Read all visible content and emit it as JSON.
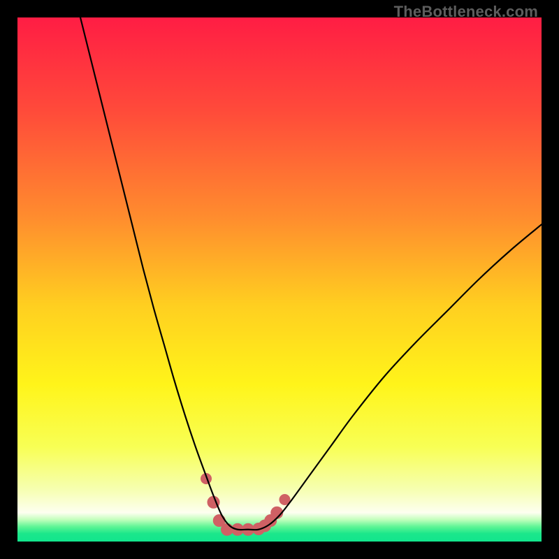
{
  "watermark": "TheBottleneck.com",
  "colors": {
    "frame": "#000000",
    "marker": "#cf6064",
    "curve": "#000000"
  },
  "chart_data": {
    "type": "line",
    "title": "",
    "xlabel": "",
    "ylabel": "",
    "xlim": [
      0,
      100
    ],
    "ylim": [
      0,
      100
    ],
    "grid": false,
    "legend": false,
    "gradient_stops": [
      {
        "offset": 0.0,
        "color": "#ff1d44"
      },
      {
        "offset": 0.18,
        "color": "#ff4b3a"
      },
      {
        "offset": 0.38,
        "color": "#ff8c2e"
      },
      {
        "offset": 0.55,
        "color": "#ffcf20"
      },
      {
        "offset": 0.7,
        "color": "#fff41a"
      },
      {
        "offset": 0.82,
        "color": "#f8ff55"
      },
      {
        "offset": 0.9,
        "color": "#f6ffb0"
      },
      {
        "offset": 0.945,
        "color": "#fdfff0"
      },
      {
        "offset": 0.958,
        "color": "#c3ffbd"
      },
      {
        "offset": 0.972,
        "color": "#5cf595"
      },
      {
        "offset": 0.985,
        "color": "#1be78b"
      },
      {
        "offset": 1.0,
        "color": "#12e58d"
      }
    ],
    "series": [
      {
        "name": "bottleneck-curve",
        "x": [
          12.0,
          14.0,
          16.0,
          18.0,
          20.0,
          22.0,
          24.0,
          26.0,
          28.0,
          30.0,
          32.0,
          34.0,
          36.0,
          37.5,
          39.0,
          40.5,
          42.0,
          44.0,
          46.0,
          48.0,
          50.0,
          52.0,
          56.0,
          60.0,
          64.0,
          70.0,
          76.0,
          82.0,
          88.0,
          94.0,
          100.0
        ],
        "y": [
          100.0,
          92.0,
          84.0,
          76.0,
          68.0,
          60.0,
          52.0,
          44.5,
          37.5,
          30.5,
          24.0,
          18.0,
          12.5,
          8.5,
          5.0,
          3.0,
          2.3,
          2.3,
          2.3,
          3.2,
          5.0,
          7.5,
          13.0,
          18.5,
          24.0,
          31.5,
          38.0,
          44.0,
          50.0,
          55.5,
          60.5
        ]
      }
    ],
    "markers": {
      "name": "highlight-points",
      "x": [
        36.0,
        37.4,
        38.5,
        40.0,
        42.0,
        44.0,
        46.0,
        47.2,
        48.3,
        49.5,
        51.0
      ],
      "y": [
        12.0,
        7.5,
        4.0,
        2.3,
        2.3,
        2.3,
        2.4,
        3.0,
        4.0,
        5.5,
        8.0
      ],
      "radius": [
        8,
        9,
        9,
        9,
        9,
        9,
        9,
        9,
        9,
        9,
        8
      ]
    }
  }
}
